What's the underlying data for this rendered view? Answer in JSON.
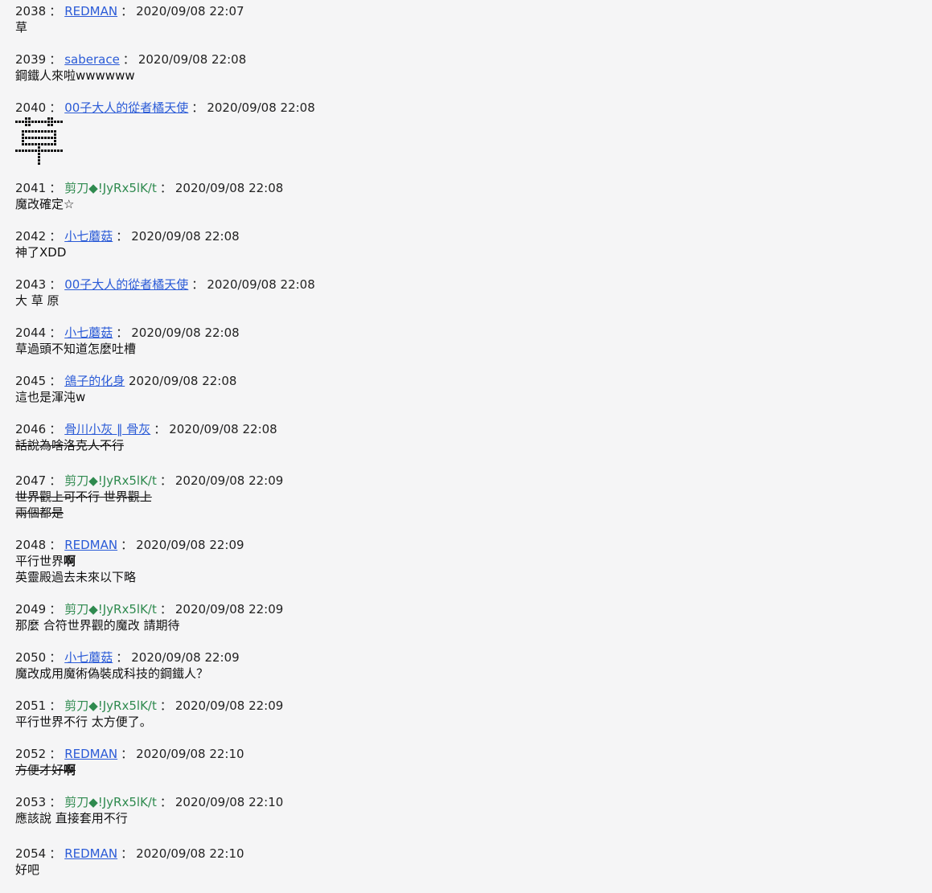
{
  "posts": [
    {
      "num": "2038",
      "sep": "：",
      "name": "REDMAN",
      "name_style": "link",
      "date": "2020/09/08 22:07",
      "lines": [
        {
          "t": "草"
        }
      ]
    },
    {
      "num": "2039",
      "sep": "：",
      "name": "saberace",
      "name_style": "link",
      "date": "2020/09/08 22:08",
      "lines": [
        {
          "t": "鋼鐵人來啦wwwwww"
        }
      ]
    },
    {
      "num": "2040",
      "sep": "：",
      "name": "00子大人的從者橘天使",
      "name_style": "link",
      "date": "2020/09/08 22:08",
      "lines": [],
      "image": "草"
    },
    {
      "num": "2041",
      "sep": "：",
      "name": "剪刀◆!JyRx5lK/t",
      "name_style": "trip",
      "date": "2020/09/08 22:08",
      "lines": [
        {
          "t": "魔改確定☆"
        }
      ]
    },
    {
      "num": "2042",
      "sep": "：",
      "name": "小七蘑菇",
      "name_style": "link",
      "date": "2020/09/08 22:08",
      "lines": [
        {
          "t": "神了XDD"
        }
      ]
    },
    {
      "num": "2043",
      "sep": "：",
      "name": "00子大人的從者橘天使",
      "name_style": "link",
      "date": "2020/09/08 22:08",
      "lines": [
        {
          "t": "大 草 原"
        }
      ]
    },
    {
      "num": "2044",
      "sep": "：",
      "name": "小七蘑菇",
      "name_style": "link",
      "date": "2020/09/08 22:08",
      "lines": [
        {
          "t": "草過頭不知道怎麼吐槽"
        }
      ]
    },
    {
      "num": "2045",
      "sep": "：",
      "name": "鴿子的化身",
      "name_style": "link",
      "date": "2020/09/08 22:08",
      "lines": [
        {
          "t": "這也是渾沌w"
        }
      ]
    },
    {
      "num": "2046",
      "sep": "：",
      "name": "骨川小灰 ‖ 骨灰",
      "name_style": "link",
      "date": "2020/09/08 22:08",
      "lines": [
        {
          "t": "話說為啥洛克人不行",
          "strike": true
        }
      ]
    },
    {
      "num": "2047",
      "sep": "：",
      "name": "剪刀◆!JyRx5lK/t",
      "name_style": "trip",
      "date": "2020/09/08 22:09",
      "lines": [
        {
          "t": "世界觀上可不行 世界觀上",
          "strike": true
        },
        {
          "t": "兩個都是",
          "strike": true
        }
      ]
    },
    {
      "num": "2048",
      "sep": "：",
      "name": "REDMAN",
      "name_style": "link",
      "date": "2020/09/08 22:09",
      "lines": [
        {
          "t": "平行世界",
          "bold": "啊"
        },
        {
          "t": "英靈殿過去未來以下略"
        }
      ]
    },
    {
      "num": "2049",
      "sep": "：",
      "name": "剪刀◆!JyRx5lK/t",
      "name_style": "trip",
      "date": "2020/09/08 22:09",
      "lines": [
        {
          "t": "那麼 合符世界觀的魔改 請期待"
        }
      ]
    },
    {
      "num": "2050",
      "sep": "：",
      "name": "小七蘑菇",
      "name_style": "link",
      "date": "2020/09/08 22:09",
      "lines": [
        {
          "t": "魔改成用魔術偽裝成科技的鋼鐵人？"
        }
      ]
    },
    {
      "num": "2051",
      "sep": "：",
      "name": "剪刀◆!JyRx5lK/t",
      "name_style": "trip",
      "date": "2020/09/08 22:09",
      "lines": [
        {
          "t": "平行世界不行 太方便了。"
        }
      ]
    },
    {
      "num": "2052",
      "sep": "：",
      "name": "REDMAN",
      "name_style": "link",
      "date": "2020/09/08 22:10",
      "lines": [
        {
          "t": "方便才好",
          "strike": true,
          "bold": "啊"
        }
      ]
    },
    {
      "num": "2053",
      "sep": "：",
      "name": "剪刀◆!JyRx5lK/t",
      "name_style": "trip",
      "date": "2020/09/08 22:10",
      "lines": [
        {
          "t": "應該說 直接套用不行"
        }
      ]
    },
    {
      "num": "2054",
      "sep": "：",
      "name": "REDMAN",
      "name_style": "link",
      "date": "2020/09/08 22:10",
      "lines": [
        {
          "t": "好吧"
        }
      ]
    }
  ],
  "colors": {
    "background": "#f5f5f6",
    "link": "#2b5bd7",
    "trip": "#2f8a4f",
    "text": "#222222"
  }
}
